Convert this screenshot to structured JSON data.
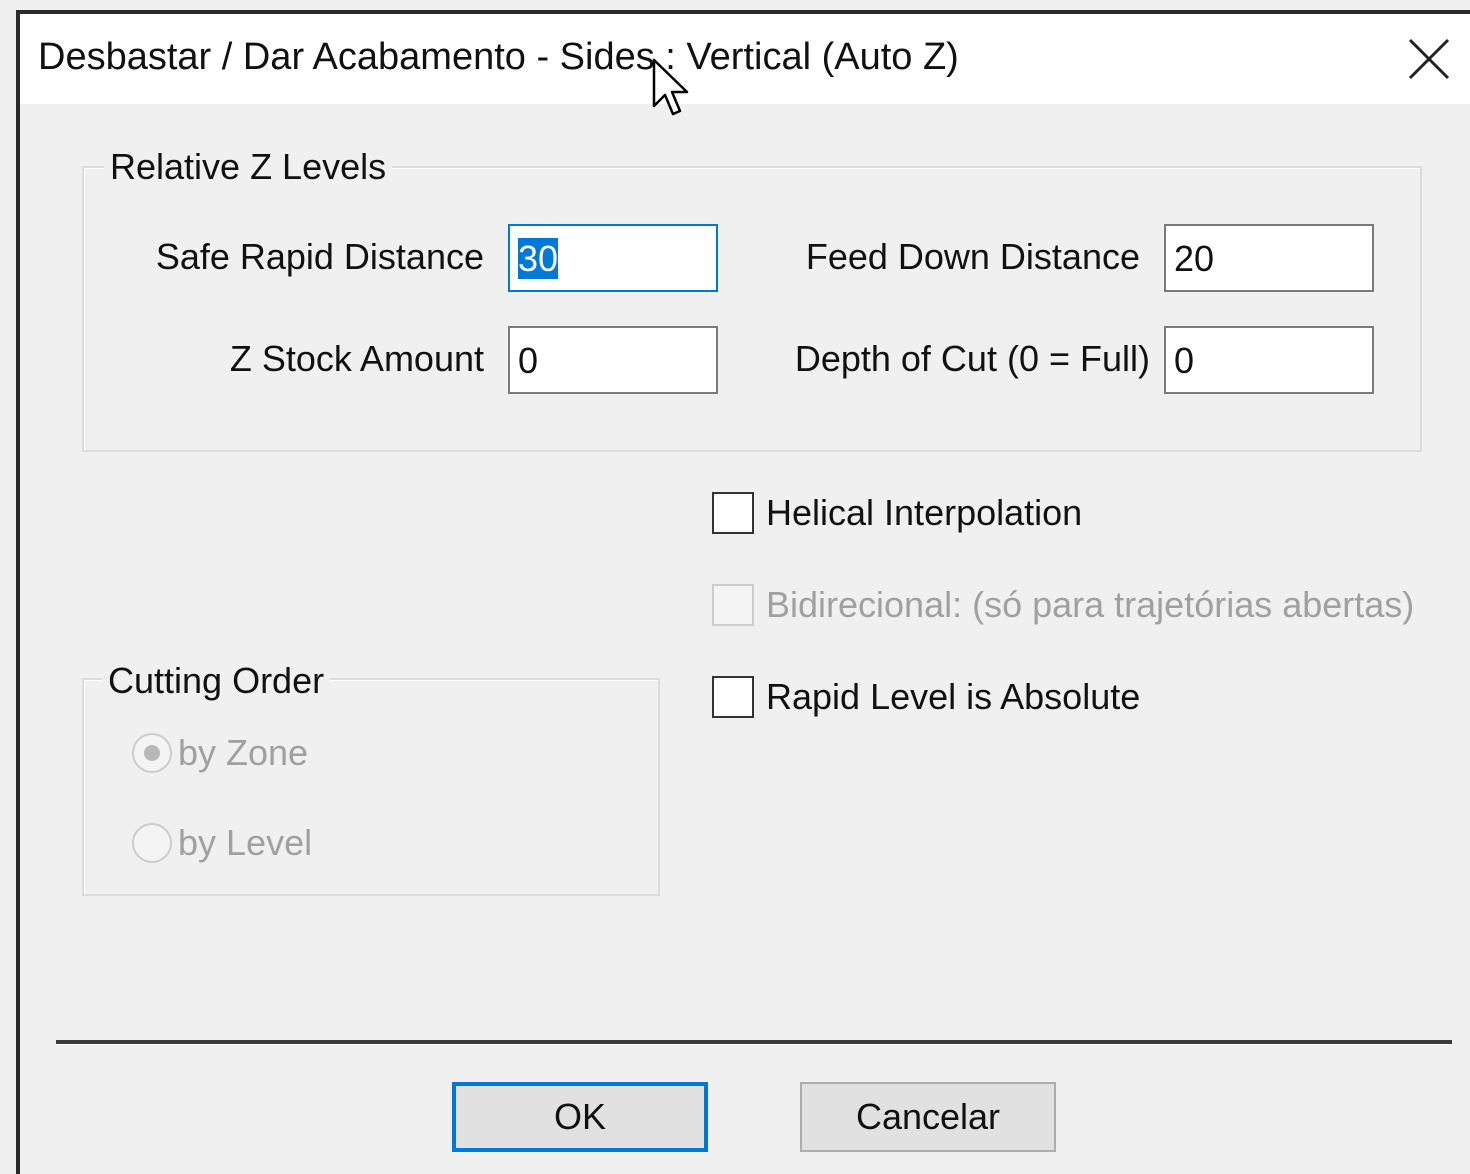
{
  "window": {
    "title": "Desbastar / Dar Acabamento - Sides : Vertical (Auto Z)",
    "close_icon": "close-icon"
  },
  "relative_z": {
    "group_label": "Relative Z Levels",
    "safe_rapid_label": "Safe Rapid Distance",
    "safe_rapid_value": "30",
    "feed_down_label": "Feed Down Distance",
    "feed_down_value": "20",
    "z_stock_label": "Z Stock Amount",
    "z_stock_value": "0",
    "depth_cut_label": "Depth of Cut (0 = Full)",
    "depth_cut_value": "0"
  },
  "options": {
    "helical_label": "Helical Interpolation",
    "helical_checked": false,
    "bidirectional_label": "Bidirecional: (só para trajetórias abertas)",
    "bidirectional_checked": false,
    "bidirectional_enabled": false,
    "rapid_absolute_label": "Rapid Level is Absolute",
    "rapid_absolute_checked": false
  },
  "cutting_order": {
    "group_label": "Cutting Order",
    "by_zone_label": "by Zone",
    "by_zone_selected": true,
    "by_level_label": "by Level",
    "by_level_selected": false,
    "enabled": false
  },
  "buttons": {
    "ok_label": "OK",
    "cancel_label": "Cancelar"
  },
  "colors": {
    "focus_accent": "#0078d7",
    "dialog_bg": "#f0f0f0"
  }
}
